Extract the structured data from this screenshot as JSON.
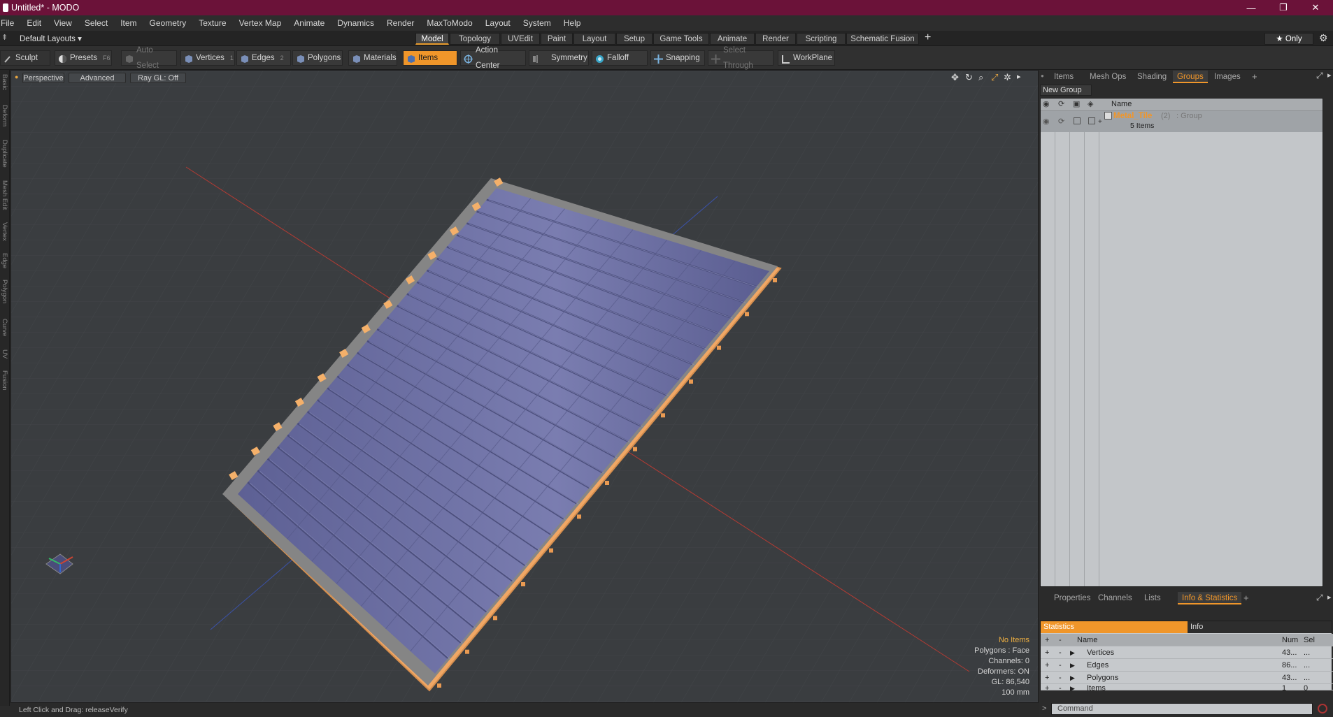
{
  "window": {
    "title": "Untitled* - MODO",
    "minimize": "—",
    "maximize": "❐",
    "close": "✕"
  },
  "menu": [
    "File",
    "Edit",
    "View",
    "Select",
    "Item",
    "Geometry",
    "Texture",
    "Vertex Map",
    "Animate",
    "Dynamics",
    "Render",
    "MaxToModo",
    "Layout",
    "System",
    "Help"
  ],
  "layoutbar": {
    "default_layouts": "Default Layouts ▾",
    "tabs": [
      "Model",
      "Topology",
      "UVEdit",
      "Paint",
      "Layout",
      "Setup",
      "Game Tools",
      "Animate",
      "Render",
      "Scripting",
      "Schematic Fusion"
    ],
    "add": "+",
    "only": "★  Only",
    "gear": "⚙"
  },
  "toolbar": {
    "sculpt": "Sculpt",
    "presets": "Presets",
    "presets_key": "F6",
    "auto_select": "Auto Select",
    "vertices": "Vertices",
    "vertices_key": "1",
    "edges": "Edges",
    "edges_key": "2",
    "polygons": "Polygons",
    "materials": "Materials",
    "items": "Items",
    "action_center": "Action Center",
    "symmetry": "Symmetry",
    "falloff": "Falloff",
    "snapping": "Snapping",
    "select_through": "Select Through",
    "workplane": "WorkPlane"
  },
  "leftstrip": [
    "Basic",
    "Deform",
    "Duplicate",
    "Mesh Edit",
    "Vertex",
    "Edge",
    "Polygon",
    "Curve",
    "UV",
    "Fusion"
  ],
  "viewport": {
    "perspective": "Perspective",
    "advanced": "Advanced",
    "raygl": "Ray GL: Off",
    "info": {
      "no_items": "No Items",
      "polygons": "Polygons : Face",
      "channels": "Channels: 0",
      "deformers": "Deformers: ON",
      "gl": "GL: 86,540",
      "scale": "100 mm"
    }
  },
  "status": {
    "hint": "Left Click and Drag:   releaseVerify"
  },
  "right_panel": {
    "top_tabs": [
      "Items",
      "Mesh Ops",
      "Shading",
      "Groups",
      "Images"
    ],
    "active_top": "Groups",
    "new_group": "New Group",
    "col_name": "Name",
    "group": {
      "name": "Metal_Tile",
      "count": "(2)",
      "type": ": Group",
      "items": "5 Items"
    },
    "bottom_tabs": [
      "Properties",
      "Channels",
      "Lists",
      "Info & Statistics"
    ],
    "active_bottom": "Info & Statistics",
    "stats_tabs": {
      "statistics": "Statistics",
      "info": "Info"
    },
    "stats_headers": {
      "name": "Name",
      "num": "Num",
      "sel": "Sel"
    },
    "stats_rows": [
      {
        "name": "Vertices",
        "num": "43...",
        "sel": "..."
      },
      {
        "name": "Edges",
        "num": "86...",
        "sel": "..."
      },
      {
        "name": "Polygons",
        "num": "43...",
        "sel": "..."
      },
      {
        "name": "Items",
        "num": "1",
        "sel": "0"
      }
    ],
    "command_placeholder": "Command"
  },
  "colors": {
    "title_bar": "#6b1239",
    "accent": "#f0962a",
    "tile": "#6c6fa0",
    "frame": "#8e8e8e"
  }
}
